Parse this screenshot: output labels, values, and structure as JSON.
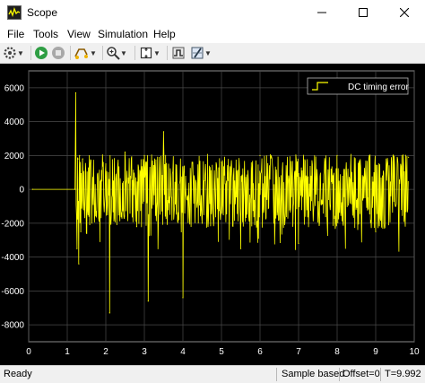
{
  "window": {
    "title": "Scope"
  },
  "menu": [
    "File",
    "Tools",
    "View",
    "Simulation",
    "Help"
  ],
  "toolbar": {
    "icons": [
      "settings-icon",
      "run-icon",
      "stop-icon",
      "highlight-icon",
      "zoom-icon",
      "autoscale-icon",
      "triggers-icon",
      "cursor-measure-icon"
    ]
  },
  "chart_data": {
    "type": "line",
    "title": "",
    "xlabel": "",
    "ylabel": "",
    "xlim": [
      0,
      10
    ],
    "ylim": [
      -9000,
      7000
    ],
    "x_ticks": [
      "0",
      "1",
      "2",
      "3",
      "4",
      "5",
      "6",
      "7",
      "8",
      "9",
      "10"
    ],
    "y_ticks": [
      "6000",
      "4000",
      "2000",
      "0",
      "-2000",
      "-4000",
      "-6000",
      "-8000"
    ],
    "grid": true,
    "legend_position": "top-right",
    "series": [
      {
        "name": "DC timing error",
        "color": "#ffff00",
        "x": [
          0.1,
          1.2,
          1.22,
          1.25,
          1.28,
          1.3,
          1.32,
          1.35,
          1.4,
          1.5,
          2.0,
          2.1,
          2.5,
          2.8,
          3.0,
          3.1,
          3.5,
          4.0,
          4.5,
          5.0,
          5.5,
          6.0,
          7.0,
          8.0,
          9.0,
          9.85
        ],
        "y": [
          0,
          0,
          5700,
          -3500,
          1800,
          -4400,
          2000,
          -2500,
          1800,
          -1800,
          1500,
          -7300,
          2200,
          -2200,
          2000,
          -6600,
          3400,
          -6400,
          -2000,
          1600,
          -3500,
          2000,
          -3200,
          2000,
          -2500,
          1900
        ],
        "trace_style": "dense noisy signal between about -2300 and +2100 from x=1.2 to x=9.85 with occasional spikes"
      }
    ]
  },
  "status": {
    "ready": "Ready",
    "sample": "Sample based",
    "offset": "Offset=0",
    "time": "T=9.992"
  }
}
